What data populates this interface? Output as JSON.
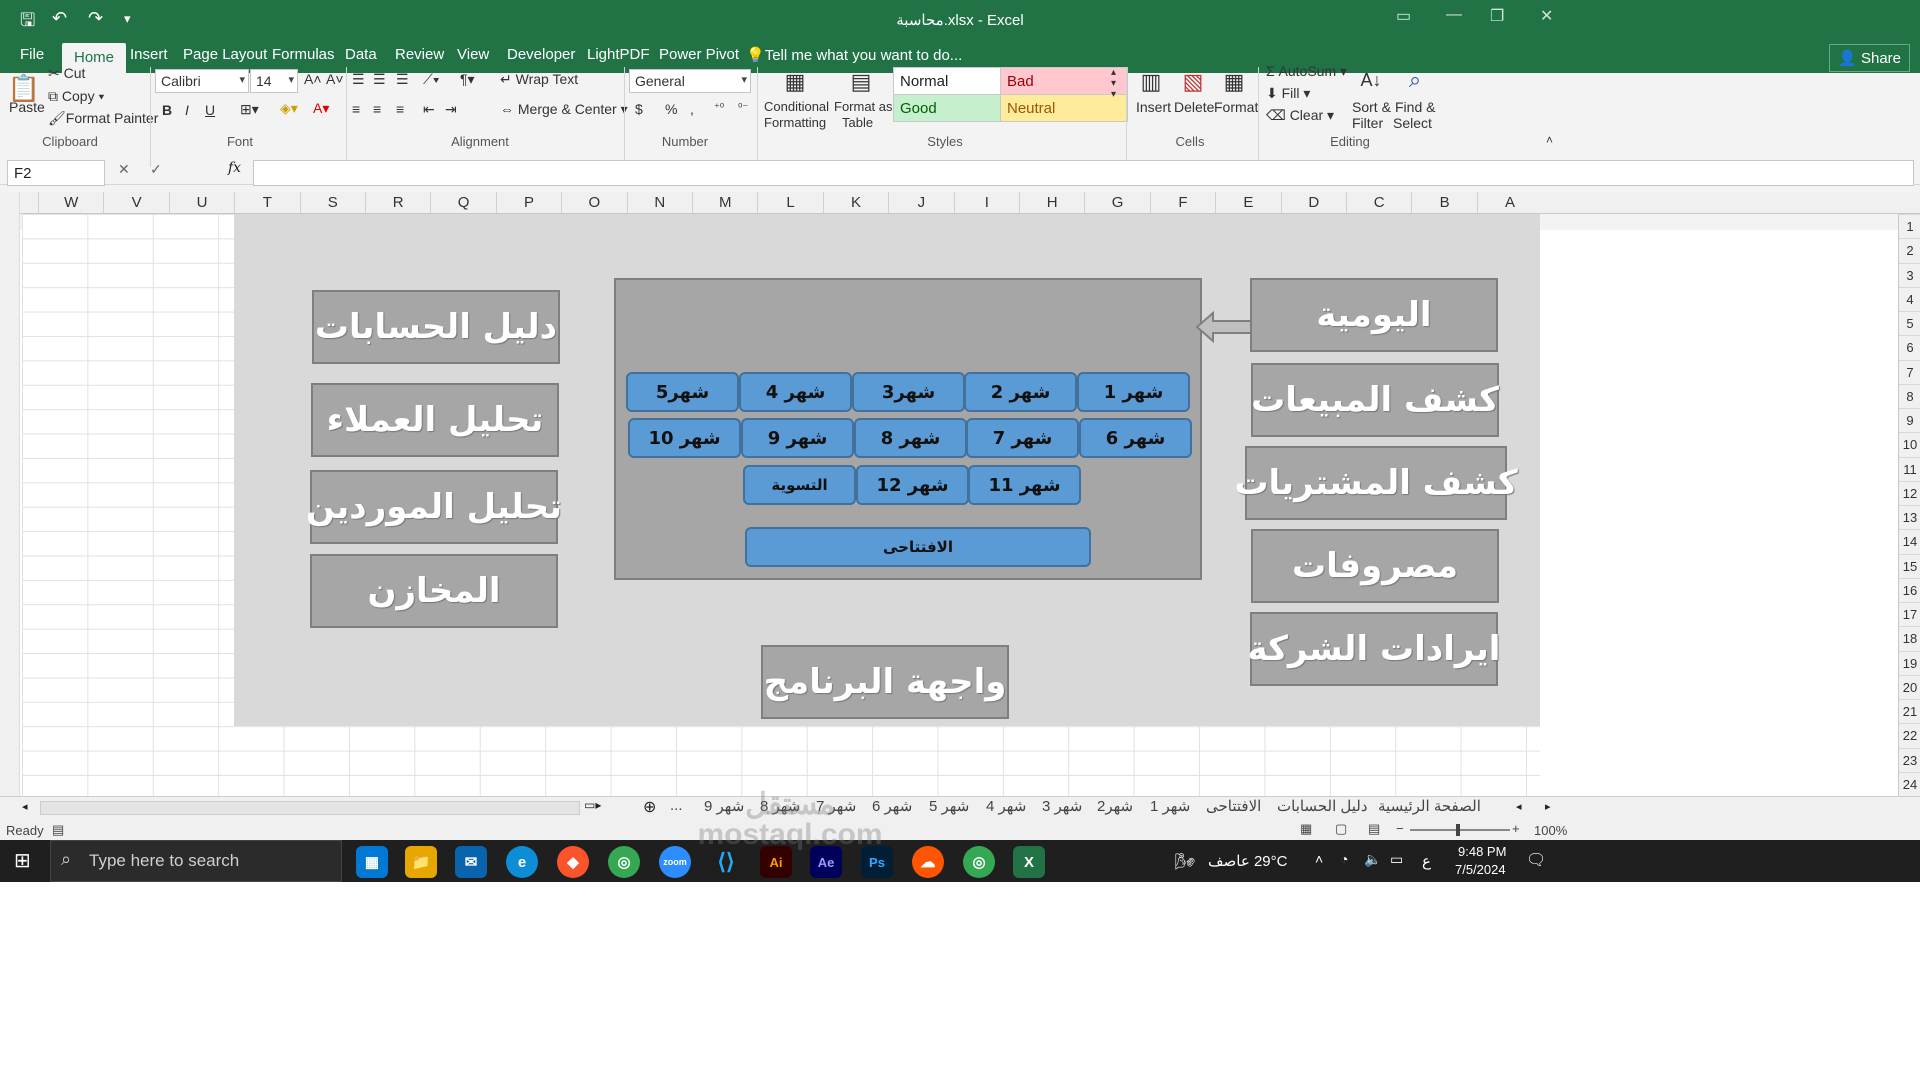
{
  "window": {
    "title": "محاسبة.xlsx - Excel"
  },
  "ribbon_tabs": [
    "File",
    "Home",
    "Insert",
    "Page Layout",
    "Formulas",
    "Data",
    "Review",
    "View",
    "Developer",
    "LightPDF",
    "Power Pivot"
  ],
  "tell_me": "Tell me what you want to do...",
  "share": "Share",
  "clipboard": {
    "paste": "Paste",
    "cut": "Cut",
    "copy": "Copy",
    "format_painter": "Format Painter",
    "label": "Clipboard"
  },
  "font": {
    "name": "Calibri",
    "size": "14",
    "label": "Font",
    "bold": "B",
    "italic": "I",
    "underline": "U"
  },
  "alignment": {
    "wrap": "Wrap Text",
    "merge": "Merge & Center",
    "label": "Alignment"
  },
  "number": {
    "format": "General",
    "label": "Number",
    "currency": "$",
    "percent": "%",
    "comma": ","
  },
  "styles": {
    "conditional": "Conditional",
    "conditional2": "Formatting",
    "format_as": "Format as",
    "format_as2": "Table",
    "normal": "Normal",
    "bad": "Bad",
    "good": "Good",
    "neutral": "Neutral",
    "label": "Styles"
  },
  "cells": {
    "insert": "Insert",
    "delete": "Delete",
    "format": "Format",
    "label": "Cells"
  },
  "editing": {
    "autosum": "AutoSum",
    "fill": "Fill",
    "clear": "Clear",
    "sort": "Sort &",
    "sort2": "Filter",
    "find": "Find &",
    "find2": "Select",
    "label": "Editing"
  },
  "formula_bar": {
    "name_box": "F2",
    "fx": "fx",
    "value": ""
  },
  "columns": [
    "W",
    "V",
    "U",
    "T",
    "S",
    "R",
    "Q",
    "P",
    "O",
    "N",
    "M",
    "L",
    "K",
    "J",
    "I",
    "H",
    "G",
    "F",
    "E",
    "D",
    "C",
    "B",
    "A"
  ],
  "rows": [
    "1",
    "2",
    "3",
    "4",
    "5",
    "6",
    "7",
    "8",
    "9",
    "10",
    "11",
    "12",
    "13",
    "14",
    "15",
    "16",
    "17",
    "18",
    "19",
    "20",
    "21",
    "22",
    "23",
    "24"
  ],
  "left_buttons": [
    "دليل الحسابات",
    "تحليل العملاء",
    "تحليل الموردين",
    "المخازن"
  ],
  "right_buttons": [
    "اليومية",
    "كشف المبيعات",
    "كشف المشتريات",
    "مصروفات",
    "ايرادات الشركة"
  ],
  "bottom_title": "واجهة البرنامج",
  "months_row1": [
    "شهر 1",
    "شهر 2",
    "شهر3",
    "شهر 4",
    "شهر5"
  ],
  "months_row2": [
    "شهر 6",
    "شهر 7",
    "شهر 8",
    "شهر 9",
    "شهر 10"
  ],
  "months_row3": [
    "شهر 11",
    "شهر 12",
    "التسوية"
  ],
  "opening": "الافتتاحى",
  "sheet_tabs": [
    "الصفحة الرئيسية",
    "دليل الحسابات",
    "الافتتاحى",
    "شهر 1",
    "شهر2",
    "شهر 3",
    "شهر 4",
    "شهر 5",
    "شهر 6",
    "شهر 7",
    "شهر 8",
    "شهر 9",
    "..."
  ],
  "status": {
    "ready": "Ready",
    "zoom": "100%"
  },
  "taskbar": {
    "search": "Type here to search",
    "weather": "29°C  عاصف",
    "time": "9:48 PM",
    "date": "7/5/2024",
    "lang": "ع"
  },
  "watermark": "مستقل mostaql.com"
}
